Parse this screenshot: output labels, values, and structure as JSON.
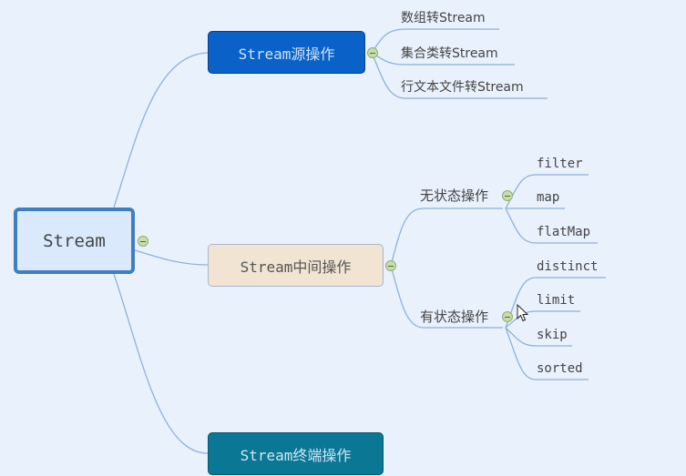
{
  "mindmap": {
    "root": {
      "label": "Stream"
    },
    "branches": [
      {
        "id": "source",
        "label": "Stream源操作",
        "color": "#0a62c8",
        "children": [
          {
            "label": "数组转Stream"
          },
          {
            "label": "集合类转Stream"
          },
          {
            "label": "行文本文件转Stream"
          }
        ]
      },
      {
        "id": "middle",
        "label": "Stream中间操作",
        "color": "#f1e4d2",
        "children": [
          {
            "label": "无状态操作",
            "children": [
              {
                "label": "filter"
              },
              {
                "label": "map"
              },
              {
                "label": "flatMap"
              }
            ]
          },
          {
            "label": "有状态操作",
            "children": [
              {
                "label": "distinct"
              },
              {
                "label": "limit"
              },
              {
                "label": "skip"
              },
              {
                "label": "sorted"
              }
            ]
          }
        ]
      },
      {
        "id": "terminal",
        "label": "Stream终端操作",
        "color": "#0a7795",
        "children": []
      }
    ]
  },
  "icons": {
    "collapse": "collapse-minus-icon",
    "cursor": "mouse-pointer-icon"
  }
}
